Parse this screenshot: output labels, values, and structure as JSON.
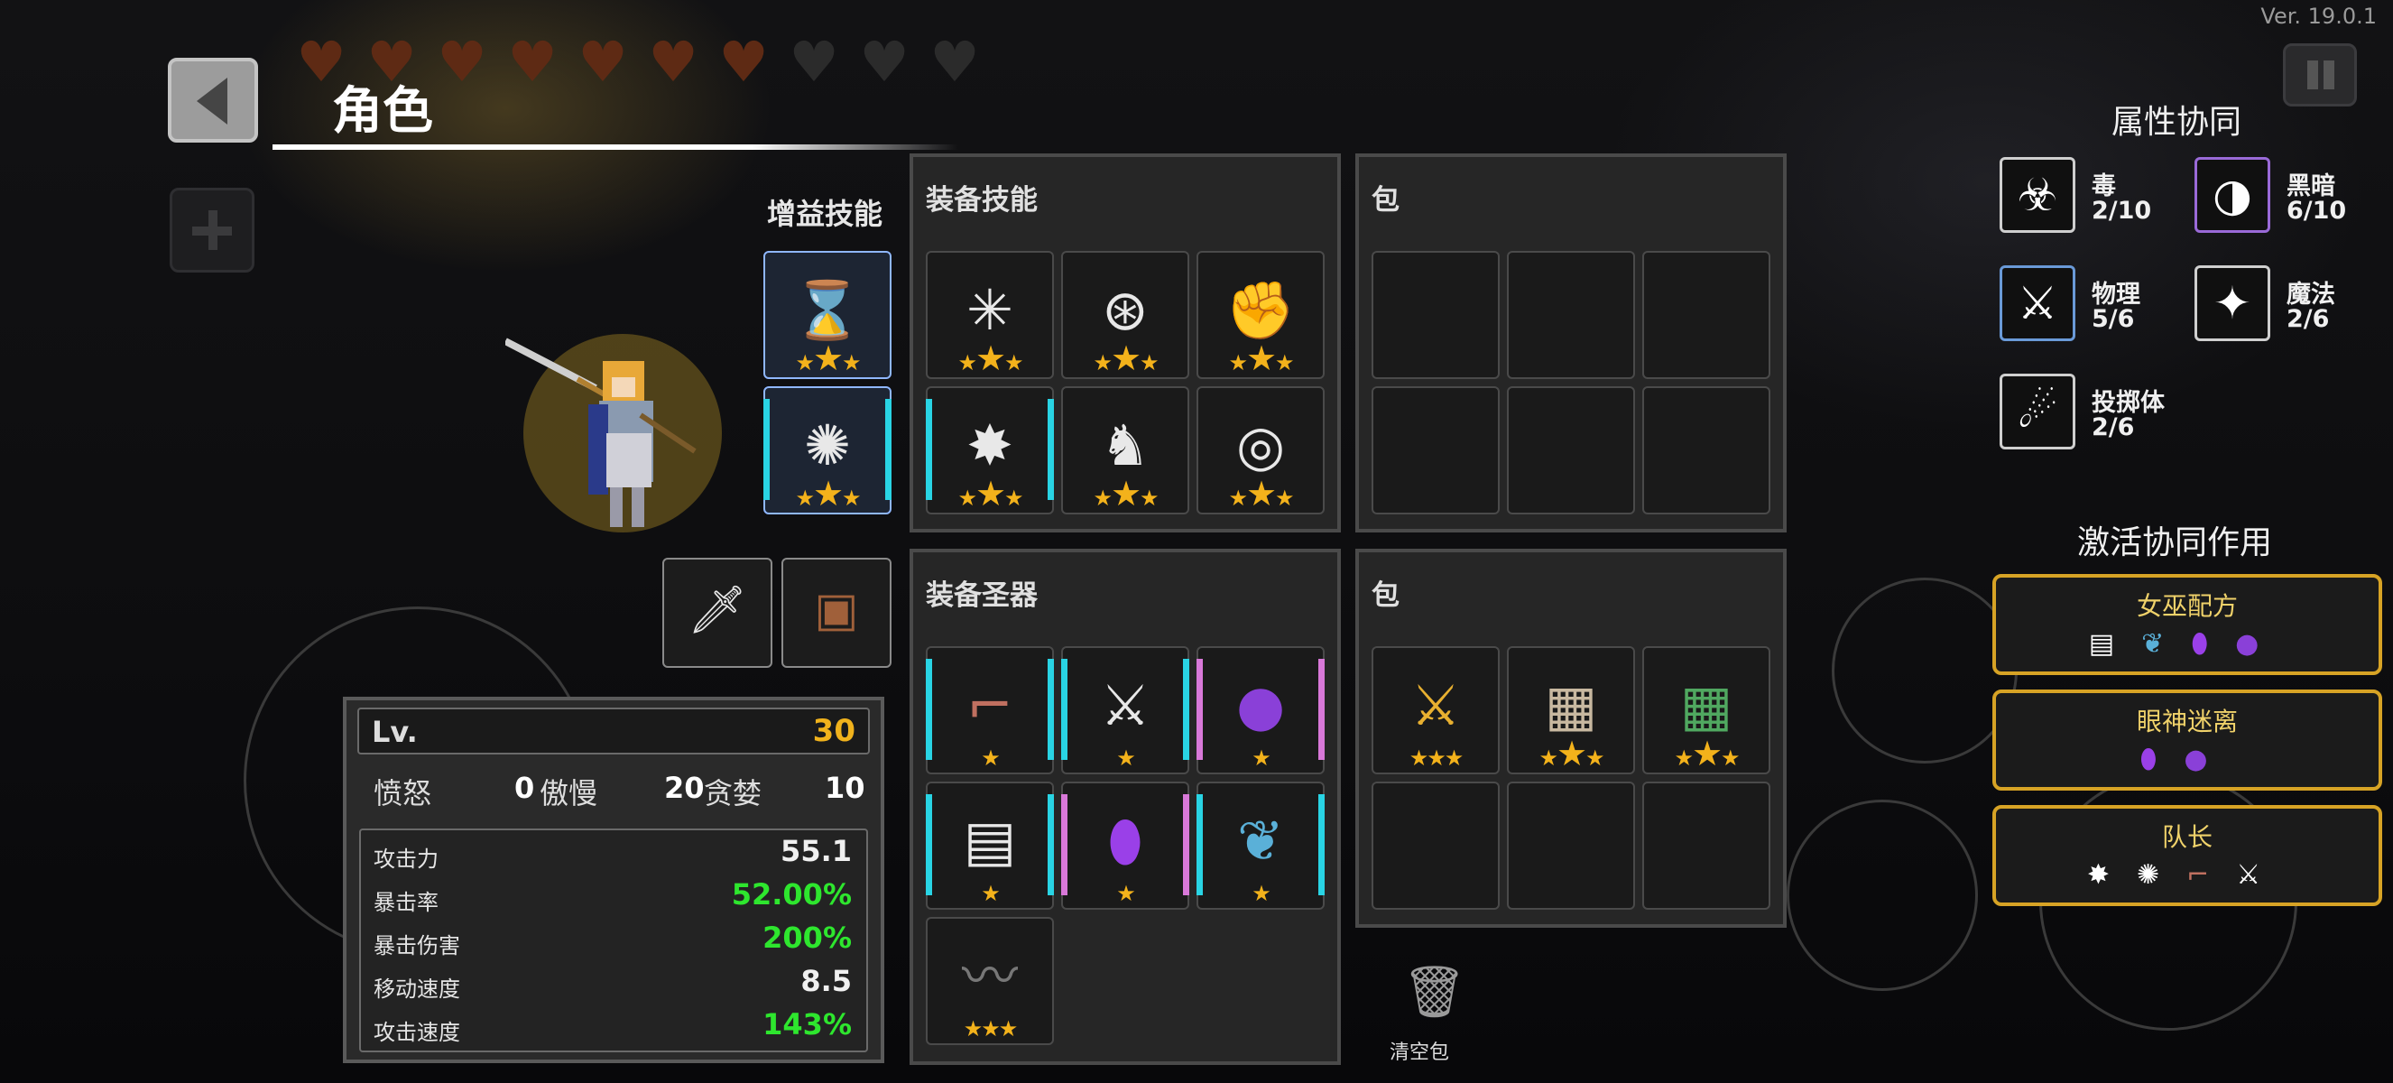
{
  "version": "Ver. 19.0.1",
  "header": {
    "title": "角色",
    "hearts_full": 7,
    "hearts_total": 10
  },
  "buff_skills": {
    "title": "增益技能"
  },
  "equip_skills": {
    "title": "装备技能"
  },
  "bag_top": {
    "title": "包"
  },
  "equip_relics": {
    "title": "装备圣器"
  },
  "bag_bottom": {
    "title": "包"
  },
  "stats": {
    "lv_label": "Lv.",
    "lv_value": "30",
    "sins": [
      {
        "label": "愤怒",
        "value": "0"
      },
      {
        "label": "傲慢",
        "value": "20"
      },
      {
        "label": "贪婪",
        "value": "10"
      }
    ],
    "rows": [
      {
        "label": "攻击力",
        "value": "55.1",
        "color": "white"
      },
      {
        "label": "暴击率",
        "value": "52.00%",
        "color": "green"
      },
      {
        "label": "暴击伤害",
        "value": "200%",
        "color": "green"
      },
      {
        "label": "移动速度",
        "value": "8.5",
        "color": "white"
      },
      {
        "label": "攻击速度",
        "value": "143%",
        "color": "green"
      }
    ]
  },
  "trash": {
    "label": "清空包"
  },
  "synergy": {
    "title": "属性协同",
    "items": [
      {
        "name": "毒",
        "count": "2/10",
        "icon": "biohazard-icon"
      },
      {
        "name": "黑暗",
        "count": "6/10",
        "icon": "dark-swirl-icon"
      },
      {
        "name": "物理",
        "count": "5/6",
        "icon": "sword-icon"
      },
      {
        "name": "魔法",
        "count": "2/6",
        "icon": "magic-star-icon"
      },
      {
        "name": "投掷体",
        "count": "2/6",
        "icon": "projectile-icon"
      }
    ]
  },
  "active_synergy": {
    "title": "激活协同作用",
    "cards": [
      {
        "name": "女巫配方"
      },
      {
        "name": "眼神迷离"
      },
      {
        "name": "队长"
      }
    ]
  },
  "colors": {
    "gold": "#f3b21b",
    "green": "#2ee62e",
    "cyan": "#29d4e4",
    "pink": "#d878d8",
    "card_border": "#d7a325"
  }
}
